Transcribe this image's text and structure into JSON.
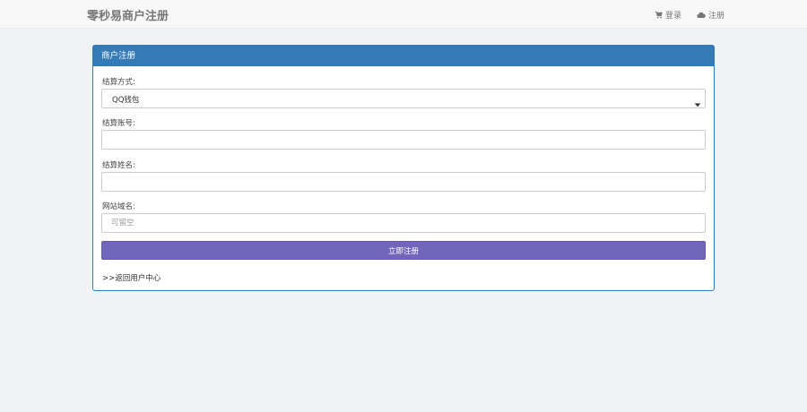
{
  "navbar": {
    "brand": "零秒易商户注册",
    "login_label": "登录",
    "register_label": "注册",
    "login_icon": "cart-icon",
    "register_icon": "cloud-icon"
  },
  "panel": {
    "title": "商户注册",
    "settlement_method": {
      "label": "结算方式:",
      "selected": "QQ钱包"
    },
    "settlement_account": {
      "label": "结算账号:",
      "value": "",
      "placeholder": ""
    },
    "settlement_name": {
      "label": "结算姓名:",
      "value": "",
      "placeholder": ""
    },
    "website_domain": {
      "label": "网站域名:",
      "value": "",
      "placeholder": "可留空"
    },
    "submit_label": "立即注册",
    "back_link": ">>返回用户中心"
  },
  "colors": {
    "primary": "#337ab7",
    "button": "#7266ba",
    "background": "#eff3f4"
  }
}
